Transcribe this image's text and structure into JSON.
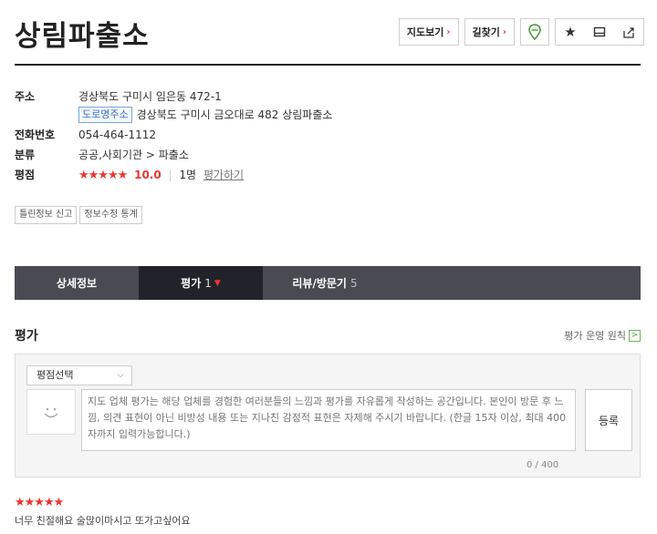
{
  "header": {
    "title": "상림파출소",
    "map_label": "지도보기",
    "route_label": "길찾기",
    "arrow": "›"
  },
  "info": {
    "address_label": "주소",
    "address": "경상북도 구미시 임은동 472-1",
    "road_tag": "도로명주소",
    "road_address": "경상북도 구미시 금오대로 482 상림파출소",
    "phone_label": "전화번호",
    "phone": "054-464-1112",
    "category_label": "분류",
    "category": "공공,사회기관 > 파출소",
    "rating_label": "평점",
    "rating_stars": "★★★★★",
    "rating_score": "10.0",
    "rating_count": "1명",
    "rate_link": "평가하기"
  },
  "small_buttons": [
    "틀린정보 신고",
    "정보수정 통계"
  ],
  "tabs": [
    {
      "label": "상세정보",
      "count": ""
    },
    {
      "label": "평가",
      "count": "1"
    },
    {
      "label": "리뷰/방문기",
      "count": "5"
    }
  ],
  "section": {
    "title": "평가",
    "policy": "평가 운영 원칙",
    "policy_arrow": ">"
  },
  "form": {
    "select_label": "평점선택",
    "placeholder": "지도 업체 평가는 해당 업체를 경험한 여러분들의 느낌과 평가를 자유롭게 작성하는 공간입니다. 본인이 방문 후 느낌, 의견 표현이 아닌 비방성 내용 또는 지나친 감정적 표현은 자제해 주시기 바랍니다. (한글 15자 이상, 최대 400자까지 입력가능합니다.)",
    "submit_label": "등록",
    "counter": "0 / 400"
  },
  "review": {
    "stars": "★★★★★",
    "text": "너무 친절해요 술많이마시고 또가고싶어요"
  },
  "colors": {
    "accent": "#e8382d",
    "tab_bar": "#4a4a52",
    "tab_active": "#22222a"
  }
}
